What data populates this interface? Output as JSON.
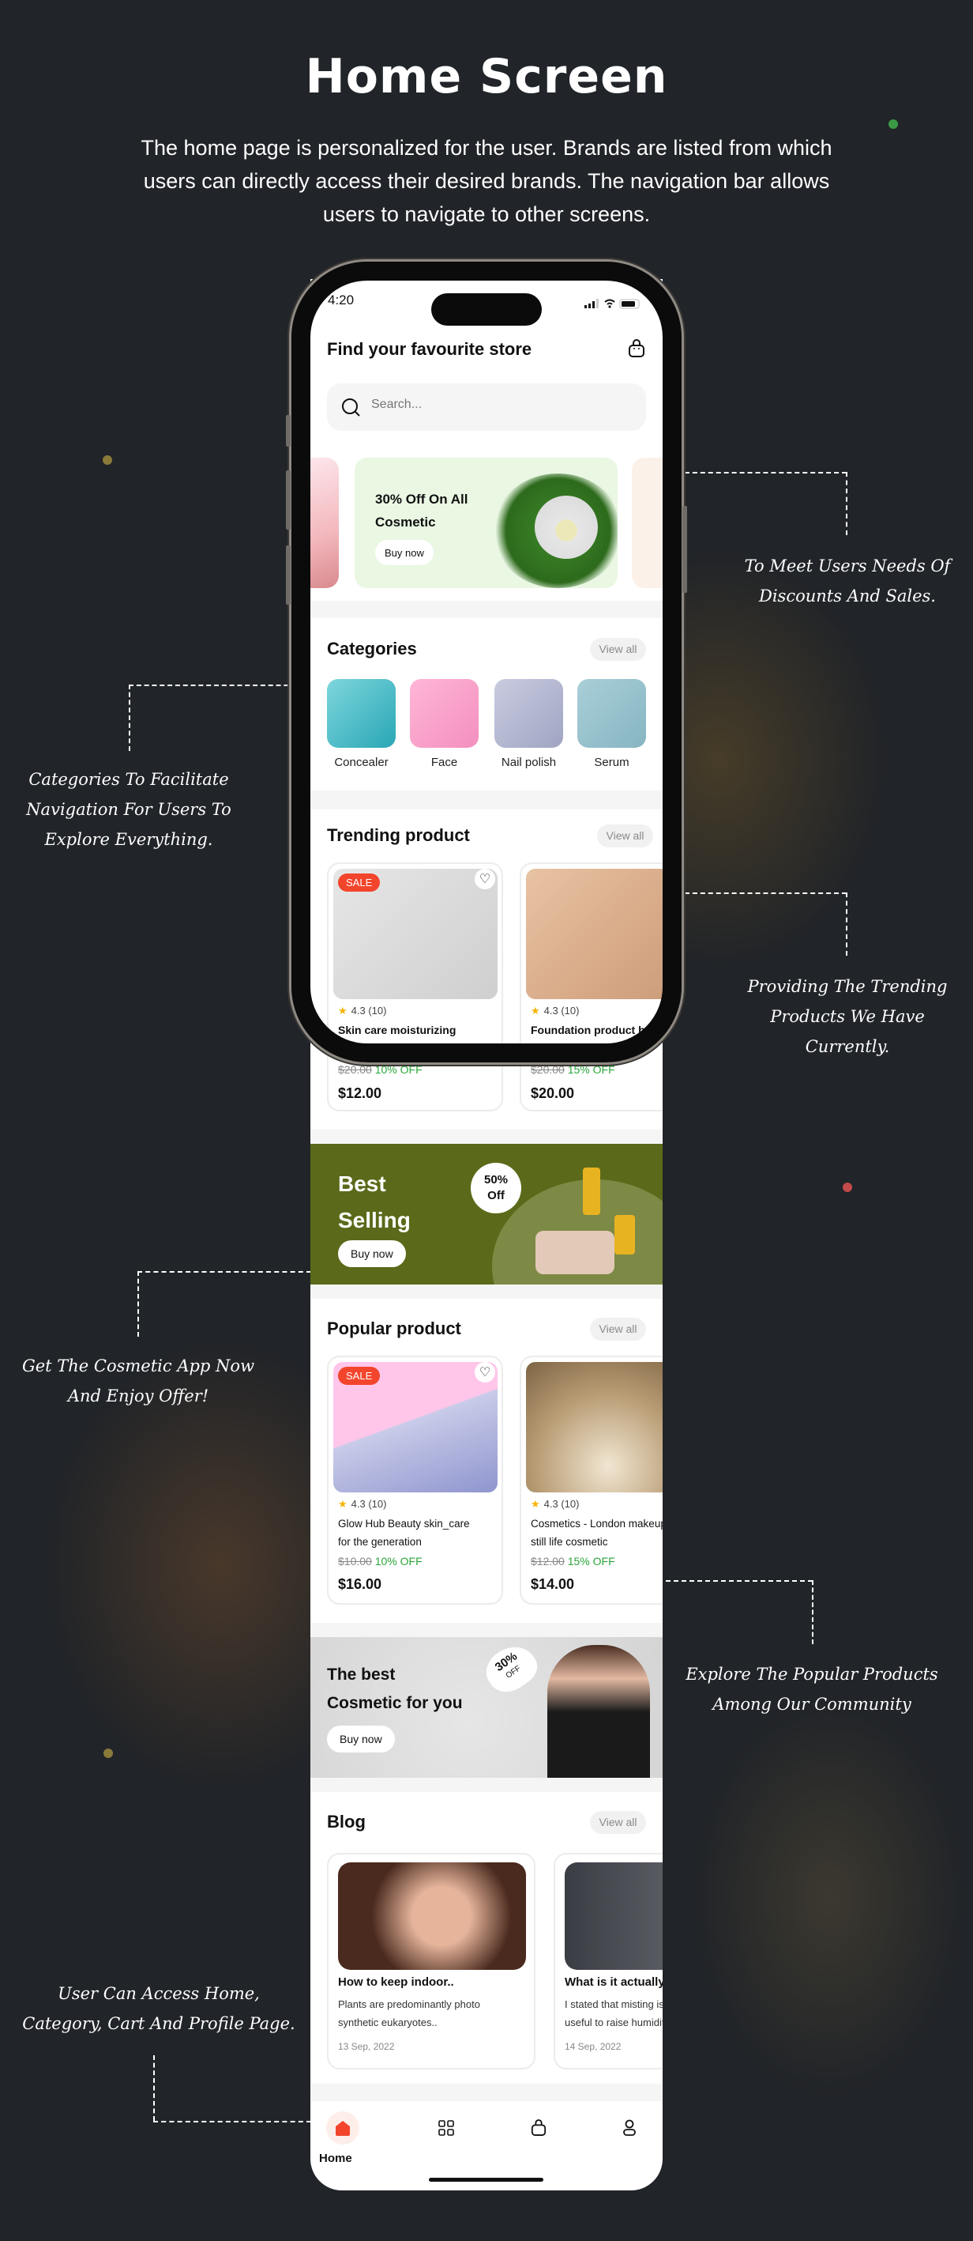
{
  "title": "Home Screen",
  "description": "The home page is personalized for the user. Brands are listed from which users can directly access their desired brands. The navigation bar allows users to navigate to other screens.",
  "annotations": {
    "banners": [
      "To Meet Users Needs Of",
      "Discounts And Sales."
    ],
    "categories": [
      "Categories To Facilitate",
      "Navigation For Users To",
      "Explore Everything."
    ],
    "trending": [
      "Providing The Trending",
      "Products We Have",
      "Currently."
    ],
    "offer": [
      "Get The Cosmetic App Now",
      "And Enjoy Offer!"
    ],
    "popular": [
      "Explore The Popular Products",
      "Among Our Community"
    ],
    "navigation": [
      "User Can Access Home,",
      "Category, Cart And Profile Page."
    ]
  },
  "colors": {
    "background": "#212428",
    "accent": "#f2452c",
    "discount": "#2aa63a",
    "best_selling": "#5a6a1a"
  },
  "app": {
    "status_time": "4:20",
    "header_title": "Find your favourite store",
    "search_placeholder": "Search...",
    "promo_banner": {
      "line1": "30% Off On All",
      "line2": "Cosmetic",
      "button": "Buy now"
    },
    "categories": {
      "title": "Categories",
      "view_all": "View all",
      "items": [
        {
          "label": "Concealer"
        },
        {
          "label": "Face"
        },
        {
          "label": "Nail polish"
        },
        {
          "label": "Serum"
        }
      ]
    },
    "trending": {
      "title": "Trending product",
      "view_all": "View all",
      "products": [
        {
          "badge": "SALE",
          "rating": "4.3 (10)",
          "name": "Skin care moisturizing",
          "old_price": "$20.00",
          "discount": "10% OFF",
          "price": "$12.00"
        },
        {
          "rating": "4.3 (10)",
          "name": "Foundation product brush",
          "old_price": "$20.00",
          "discount": "15% OFF",
          "price": "$20.00"
        }
      ]
    },
    "best_selling": {
      "line1": "Best",
      "line2": "Selling",
      "bubble1": "50%",
      "bubble2": "Off",
      "button": "Buy now"
    },
    "popular": {
      "title": "Popular product",
      "view_all": "View all",
      "products": [
        {
          "badge": "SALE",
          "rating": "4.3 (10)",
          "name1": "Glow Hub Beauty skin_care",
          "name2": "for the generation",
          "old_price": "$10.00",
          "discount": "10% OFF",
          "price": "$16.00"
        },
        {
          "rating": "4.3 (10)",
          "name1": "Cosmetics - London makeup",
          "name2": "still life cosmetic",
          "old_price": "$12.00",
          "discount": "15% OFF",
          "price": "$14.00"
        }
      ]
    },
    "best_cosmetic": {
      "line1": "The best",
      "line2": "Cosmetic for you",
      "tag1": "30%",
      "tag2": "OFF",
      "button": "Buy now"
    },
    "blog": {
      "title": "Blog",
      "view_all": "View all",
      "posts": [
        {
          "title": "How to keep indoor..",
          "excerpt": "Plants are predominantly photo\nsynthetic eukaryotes..",
          "date": "13 Sep, 2022"
        },
        {
          "title": "What is it actually",
          "excerpt": " I stated that misting is\nuseful to raise humidity",
          "date": "14 Sep, 2022"
        }
      ]
    },
    "nav": {
      "active": "Home",
      "items": [
        "home-icon",
        "grid-icon",
        "bag-icon",
        "profile-icon"
      ]
    }
  }
}
